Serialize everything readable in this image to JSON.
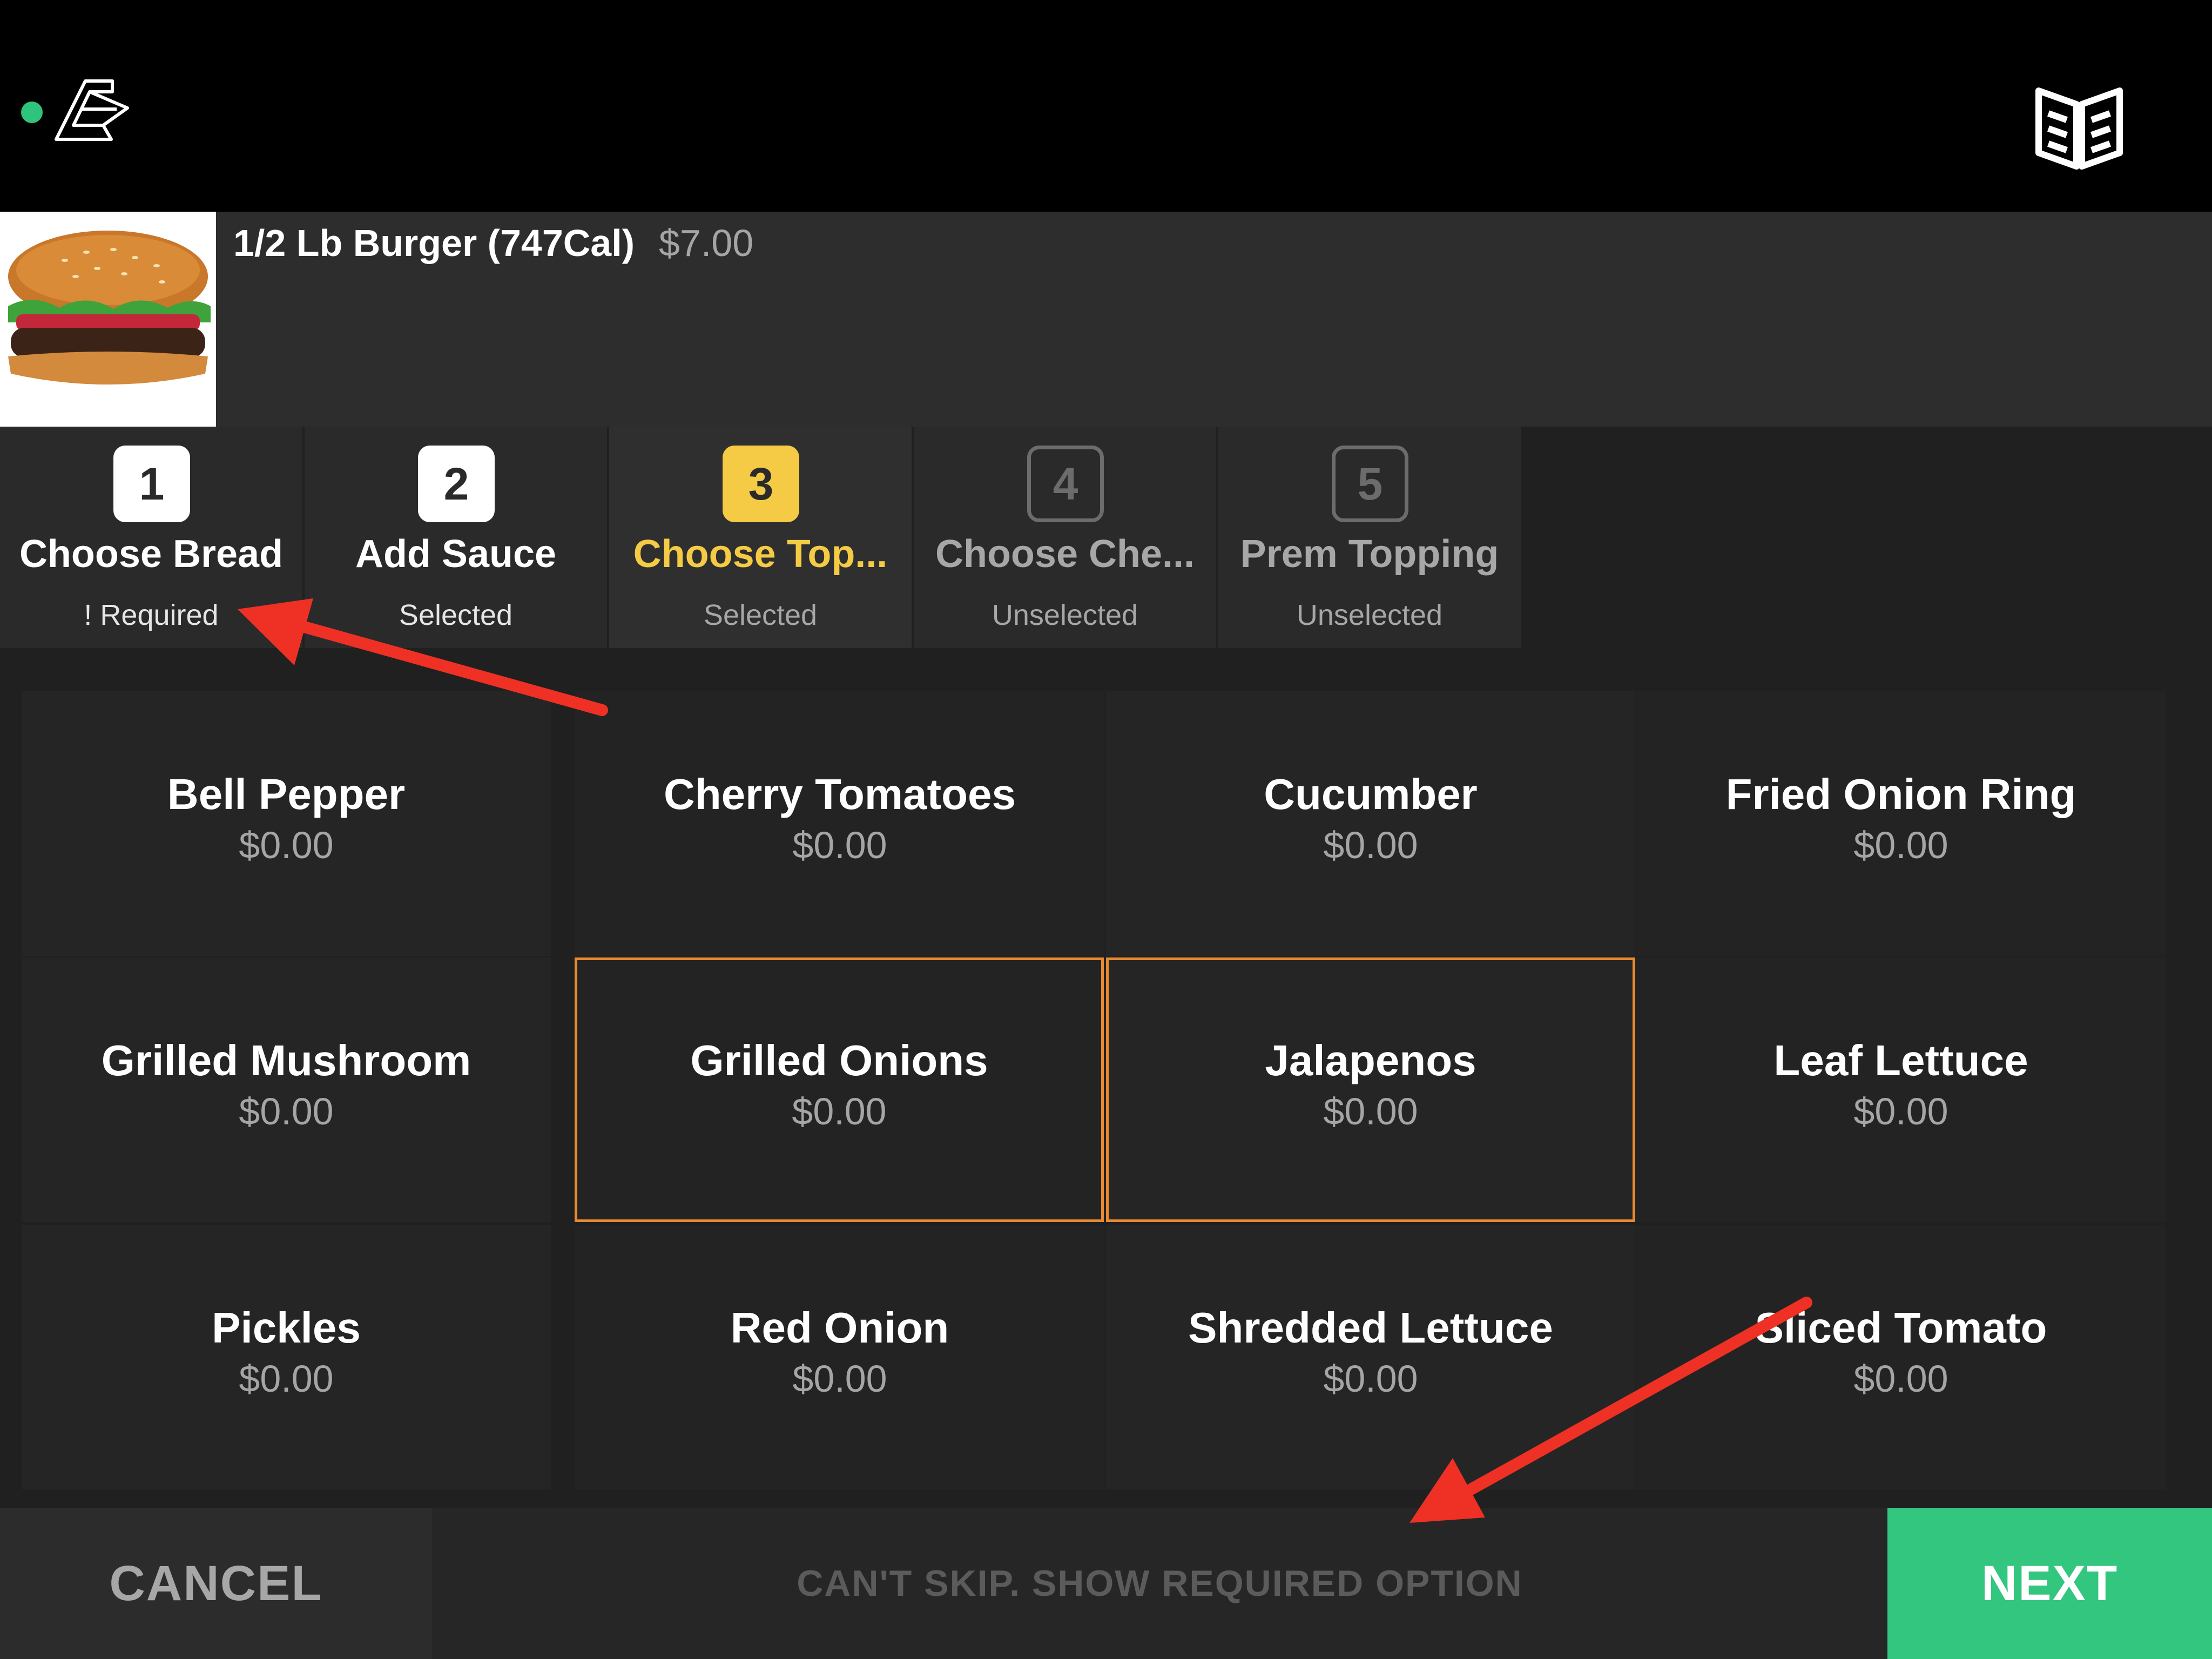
{
  "colors": {
    "accent_yellow": "#f5cb45",
    "selected_border": "#e88a32",
    "next_green": "#33c67e",
    "status_green": "#2fc47d",
    "annotation_red": "#ee3124"
  },
  "header": {
    "status_icon": "status-dot",
    "logo_icon": "logo-a-icon",
    "menu_icon": "menu-book-icon"
  },
  "item": {
    "title": "1/2 Lb Burger (747Cal)",
    "price": "$7.00",
    "image_icon": "burger-image"
  },
  "steps": [
    {
      "num": "1",
      "label": "Choose Bread",
      "status": "! Required",
      "state": "completed"
    },
    {
      "num": "2",
      "label": "Add Sauce",
      "status": "Selected",
      "state": "completed"
    },
    {
      "num": "3",
      "label": "Choose Top...",
      "status": "Selected",
      "state": "active"
    },
    {
      "num": "4",
      "label": "Choose Che...",
      "status": "Unselected",
      "state": "pending"
    },
    {
      "num": "5",
      "label": "Prem Topping",
      "status": "Unselected",
      "state": "pending"
    }
  ],
  "options": [
    {
      "name": "Bell Pepper",
      "price": "$0.00",
      "selected": false
    },
    {
      "name": "Cherry Tomatoes",
      "price": "$0.00",
      "selected": false
    },
    {
      "name": "Cucumber",
      "price": "$0.00",
      "selected": false
    },
    {
      "name": "Fried Onion Ring",
      "price": "$0.00",
      "selected": false
    },
    {
      "name": "Grilled Mushroom",
      "price": "$0.00",
      "selected": false
    },
    {
      "name": "Grilled Onions",
      "price": "$0.00",
      "selected": true
    },
    {
      "name": "Jalapenos",
      "price": "$0.00",
      "selected": true
    },
    {
      "name": "Leaf Lettuce",
      "price": "$0.00",
      "selected": false
    },
    {
      "name": "Pickles",
      "price": "$0.00",
      "selected": false
    },
    {
      "name": "Red Onion",
      "price": "$0.00",
      "selected": false
    },
    {
      "name": "Shredded Lettuce",
      "price": "$0.00",
      "selected": false
    },
    {
      "name": "Sliced Tomato",
      "price": "$0.00",
      "selected": false
    }
  ],
  "footer": {
    "cancel_label": "CANCEL",
    "skip_message": "CAN'T SKIP. SHOW REQUIRED OPTION",
    "next_label": "NEXT"
  }
}
